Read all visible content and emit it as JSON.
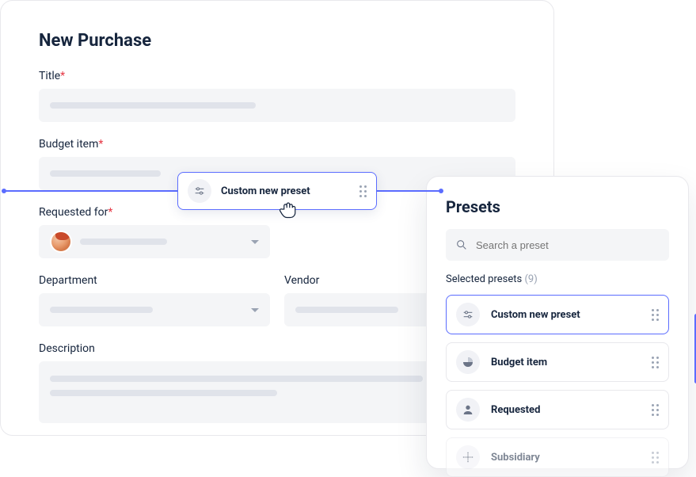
{
  "form": {
    "title": "New Purchase",
    "fields": {
      "title_label": "Title",
      "budget_label": "Budget item",
      "requested_label": "Requested for",
      "department_label": "Department",
      "vendor_label": "Vendor",
      "description_label": "Description"
    }
  },
  "drag_chip": {
    "label": "Custom new preset"
  },
  "presets": {
    "title": "Presets",
    "search_placeholder": "Search a preset",
    "selected_label": "Selected presets",
    "selected_count": "(9)",
    "items": [
      {
        "label": "Custom new preset",
        "icon": "sliders"
      },
      {
        "label": "Budget item",
        "icon": "pie"
      },
      {
        "label": "Requested",
        "icon": "person"
      },
      {
        "label": "Subsidiary",
        "icon": "hub"
      }
    ]
  }
}
